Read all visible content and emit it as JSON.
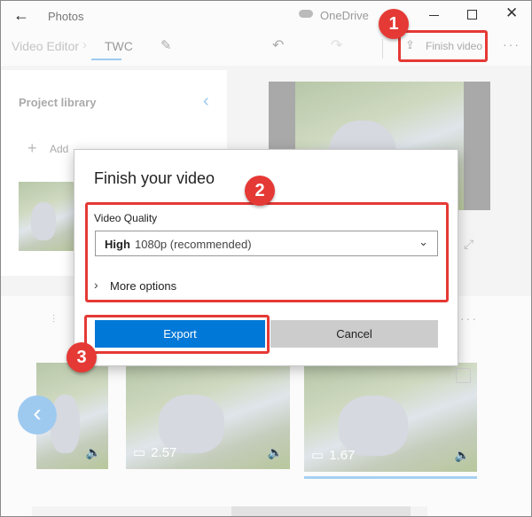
{
  "titlebar": {
    "app": "Photos",
    "cloud": "OneDrive"
  },
  "toolbar": {
    "breadcrumb_root": "Video Editor",
    "project": "TWC",
    "finish_label": "Finish video"
  },
  "library": {
    "title": "Project library",
    "add_label": "Add"
  },
  "dialog": {
    "title": "Finish your video",
    "quality_label": "Video Quality",
    "quality_value_strong": "High",
    "quality_value_rest": "1080p (recommended)",
    "more_options": "More options",
    "export_label": "Export",
    "cancel_label": "Cancel"
  },
  "storyboard": {
    "clips": [
      {
        "duration": ""
      },
      {
        "duration": "2.57"
      },
      {
        "duration": "1.67"
      }
    ]
  },
  "badges": [
    "1",
    "2",
    "3"
  ],
  "colors": {
    "accent": "#0078d7",
    "annotation": "#e53935"
  }
}
